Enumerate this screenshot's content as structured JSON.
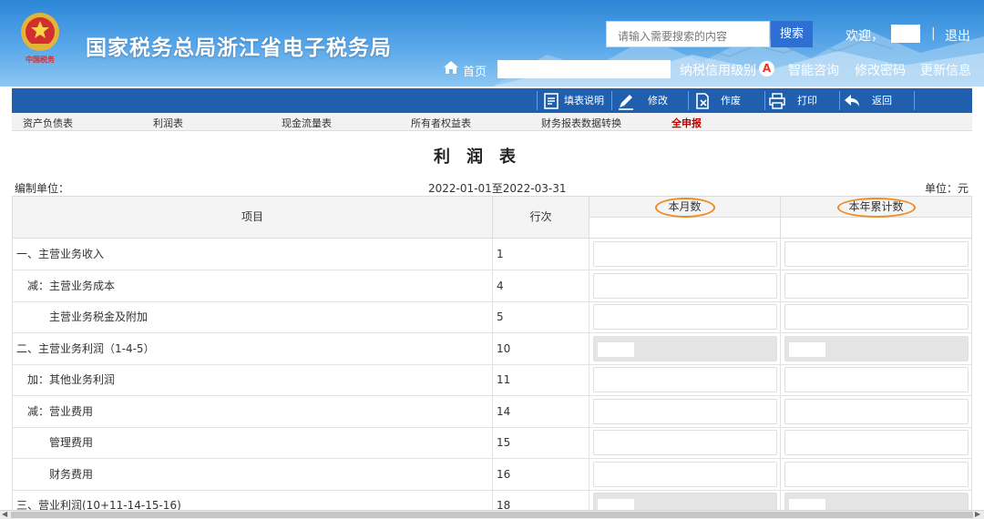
{
  "header": {
    "brand": "国家税务总局浙江省电子税务局",
    "search_placeholder": "请输入需要搜索的内容",
    "search_button": "搜索",
    "welcome": "欢迎，",
    "separator": "|",
    "logout": "退出",
    "home": "首页",
    "credit_label": "纳税信用级别",
    "credit_level": "A",
    "nav": [
      "智能咨询",
      "修改密码",
      "更新信息"
    ]
  },
  "toolbar": {
    "items": [
      {
        "label": "填表说明",
        "icon": "document-icon"
      },
      {
        "label": "修改",
        "icon": "pencil-icon"
      },
      {
        "label": "作废",
        "icon": "cancel-doc-icon"
      },
      {
        "label": "打印",
        "icon": "printer-icon"
      },
      {
        "label": "返回",
        "icon": "back-arrow-icon"
      }
    ]
  },
  "tabs": {
    "items": [
      "资产负债表",
      "利润表",
      "现金流量表",
      "所有者权益表",
      "财务报表数据转换",
      "全申报"
    ],
    "active": "全申报"
  },
  "report": {
    "title": "利润表",
    "unit_label": "编制单位：",
    "period": "2022-01-01至2022-03-31",
    "currency": "单位：元"
  },
  "table": {
    "headers": {
      "item": "项目",
      "row_no": "行次",
      "this_month": "本月数",
      "year_total": "本年累计数"
    },
    "rows": [
      {
        "name": "一、主营业务收入",
        "no": "1",
        "indent": 0,
        "readonly": false
      },
      {
        "name": "减：主营业务成本",
        "no": "4",
        "indent": 1,
        "readonly": false
      },
      {
        "name": "主营业务税金及附加",
        "no": "5",
        "indent": 2,
        "readonly": false
      },
      {
        "name": "二、主营业务利润（1-4-5）",
        "no": "10",
        "indent": 0,
        "readonly": true
      },
      {
        "name": "加：其他业务利润",
        "no": "11",
        "indent": 1,
        "readonly": false
      },
      {
        "name": "减：营业费用",
        "no": "14",
        "indent": 1,
        "readonly": false
      },
      {
        "name": "管理费用",
        "no": "15",
        "indent": 2,
        "readonly": false
      },
      {
        "name": "财务费用",
        "no": "16",
        "indent": 2,
        "readonly": false
      },
      {
        "name": "三、营业利润(10+11-14-15-16)",
        "no": "18",
        "indent": 0,
        "readonly": true
      }
    ]
  },
  "colors": {
    "header_blue": "#2b86d6",
    "toolbar_blue": "#1f5fae",
    "search_button": "#2e6fd3",
    "active_tab": "#c00000",
    "highlight_circle": "#f08a24",
    "credit_badge": "#e03a2d"
  }
}
